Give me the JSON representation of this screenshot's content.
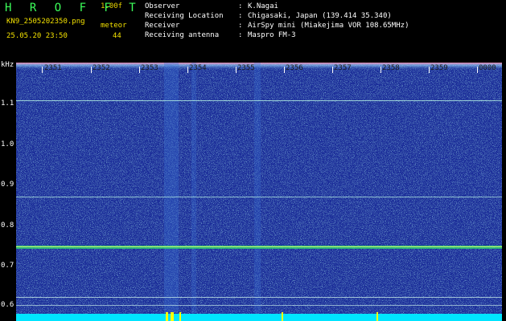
{
  "header": {
    "brand": "H R O F F T",
    "version": "1.00f",
    "filename": "KN9_2505202350.png",
    "datetime": "25.05.20 23:50",
    "meteor_label": "meteor",
    "meteor_count": "44"
  },
  "meta": [
    {
      "label": "Observer",
      "value": "K.Nagai"
    },
    {
      "label": "Receiving Location",
      "value": "Chigasaki, Japan (139.414 35.340)"
    },
    {
      "label": "Receiver",
      "value": "AirSpy mini (Miakejima VOR 108.65MHz)"
    },
    {
      "label": "Receiving antenna",
      "value": "Maspro FM-3"
    }
  ],
  "y_axis": {
    "unit": "kHz",
    "ticks": [
      "1.1",
      "1.0",
      "0.9",
      "0.8",
      "0.7",
      "0.6"
    ]
  },
  "x_axis": {
    "ticks": [
      "2351",
      "2352",
      "2353",
      "2354",
      "2355",
      "2356",
      "2357",
      "2358",
      "2359",
      "0000"
    ]
  },
  "colors": {
    "background": "#1a2f9a",
    "noise_bright": "#7fd0ff",
    "signal": "#2fe06a",
    "bottom_bar": "#00e5ff",
    "event_marks": "#ffff00"
  }
}
